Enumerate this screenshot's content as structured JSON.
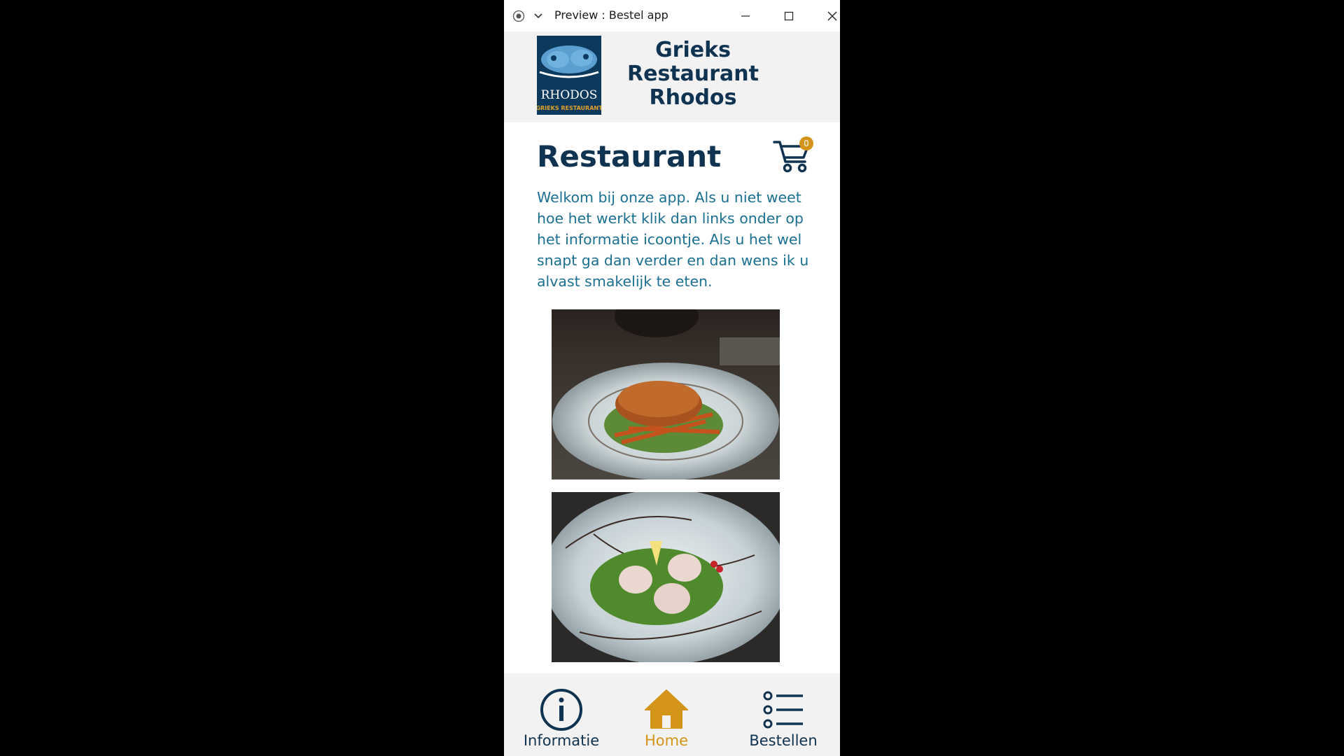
{
  "window": {
    "title": "Preview : Bestel app"
  },
  "header": {
    "title": "Grieks Restaurant Rhodos",
    "logo": {
      "text_main": "RHODOS",
      "text_sub": "GRIEKS RESTAURANT"
    }
  },
  "main": {
    "page_title": "Restaurant",
    "cart_count": "0",
    "intro_text": "Welkom bij onze app. Als u niet weet hoe het werkt klik dan links onder op het informatie icoontje. Als u het wel snapt ga dan verder en dan wens ik u alvast smakelijk te eten.",
    "photos": [
      {
        "icon": "food-photo-fried-patty"
      },
      {
        "icon": "food-photo-salad"
      }
    ]
  },
  "nav": {
    "items": [
      {
        "label": "Informatie",
        "icon": "info-icon"
      },
      {
        "label": "Home",
        "icon": "home-icon"
      },
      {
        "label": "Bestellen",
        "icon": "list-icon"
      }
    ],
    "active": "Home"
  },
  "colors": {
    "navy": "#0f3350",
    "accent": "#d4941a",
    "text_blue": "#1b6f91",
    "header_bg": "#f2f2f2"
  }
}
